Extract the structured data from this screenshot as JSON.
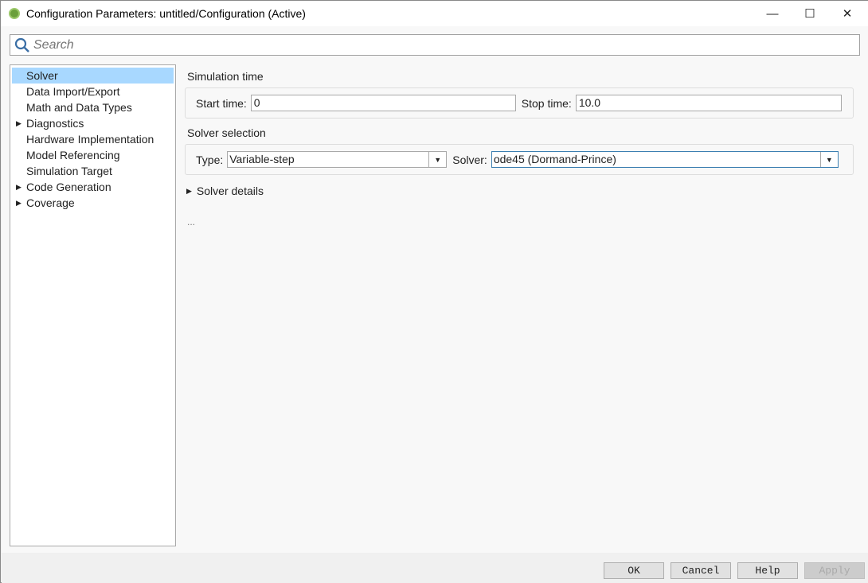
{
  "window": {
    "title": "Configuration Parameters: untitled/Configuration (Active)",
    "minimize": "—",
    "maximize": "☐",
    "close": "✕"
  },
  "search": {
    "placeholder": "Search"
  },
  "tree": [
    {
      "label": "Solver",
      "selected": true,
      "expandable": false
    },
    {
      "label": "Data Import/Export",
      "expandable": false
    },
    {
      "label": "Math and Data Types",
      "expandable": false
    },
    {
      "label": "Diagnostics",
      "expandable": true
    },
    {
      "label": "Hardware Implementation",
      "expandable": false
    },
    {
      "label": "Model Referencing",
      "expandable": false
    },
    {
      "label": "Simulation Target",
      "expandable": false
    },
    {
      "label": "Code Generation",
      "expandable": true
    },
    {
      "label": "Coverage",
      "expandable": true
    }
  ],
  "simulation_time": {
    "heading": "Simulation time",
    "start_label": "Start time:",
    "start_value": "0",
    "stop_label": "Stop time:",
    "stop_value": "10.0"
  },
  "solver_selection": {
    "heading": "Solver selection",
    "type_label": "Type:",
    "type_value": "Variable-step",
    "solver_label": "Solver:",
    "solver_value": "ode45 (Dormand-Prince)"
  },
  "solver_details": {
    "label": "Solver details"
  },
  "ellipsis": "...",
  "buttons": {
    "ok": "OK",
    "cancel": "Cancel",
    "help": "Help",
    "apply": "Apply"
  }
}
